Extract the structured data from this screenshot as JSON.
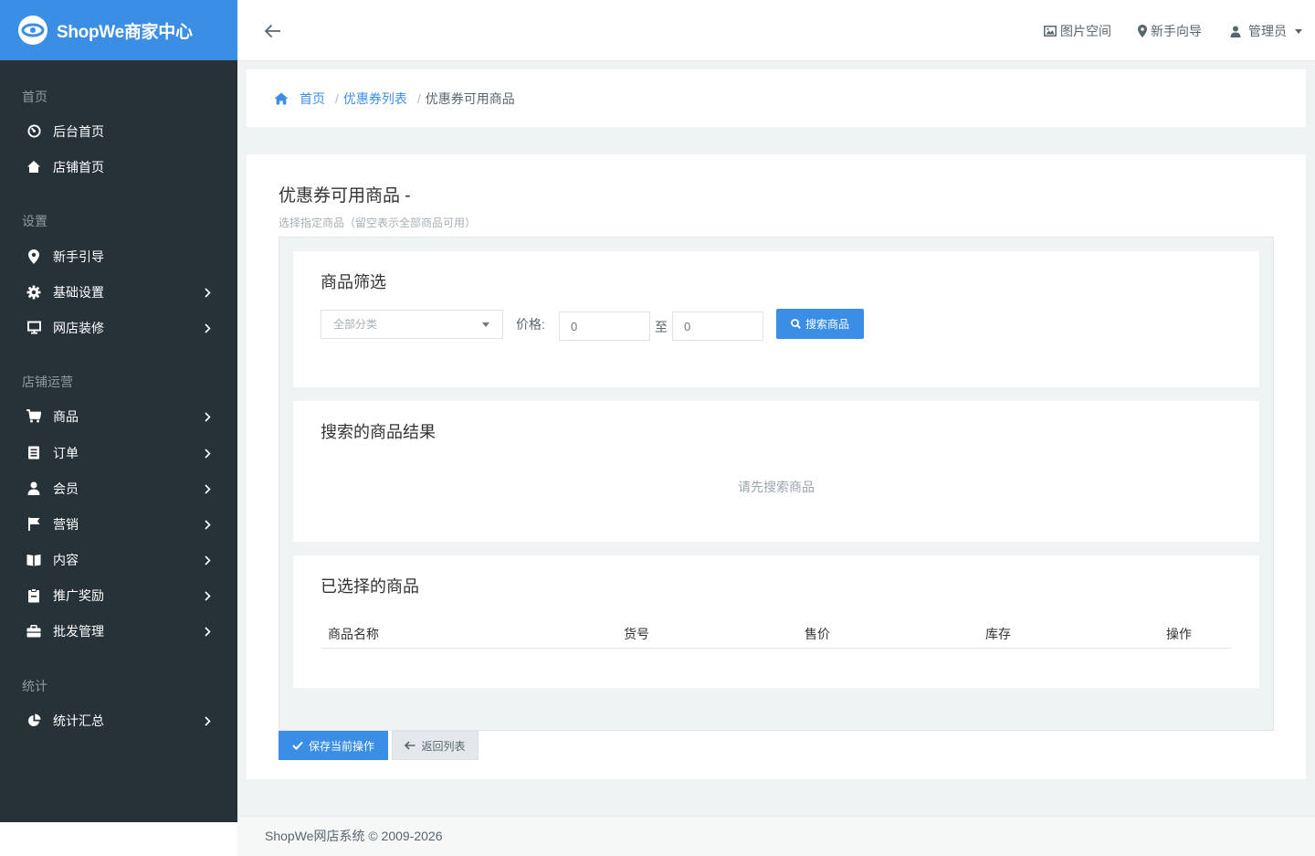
{
  "brand": {
    "title": "ShopWe商家中心"
  },
  "sidebar": {
    "sections": [
      {
        "title": "首页",
        "items": [
          {
            "label": "后台首页",
            "icon": "dashboard-icon",
            "arrow": false
          },
          {
            "label": "店铺首页",
            "icon": "home-icon",
            "arrow": false
          }
        ]
      },
      {
        "title": "设置",
        "items": [
          {
            "label": "新手引导",
            "icon": "map-marker-icon",
            "arrow": false
          },
          {
            "label": "基础设置",
            "icon": "gear-icon",
            "arrow": true
          },
          {
            "label": "网店装修",
            "icon": "monitor-icon",
            "arrow": true
          }
        ]
      },
      {
        "title": "店铺运营",
        "items": [
          {
            "label": "商品",
            "icon": "cart-icon",
            "arrow": true
          },
          {
            "label": "订单",
            "icon": "order-list-icon",
            "arrow": true
          },
          {
            "label": "会员",
            "icon": "user-icon",
            "arrow": true
          },
          {
            "label": "营销",
            "icon": "flag-icon",
            "arrow": true
          },
          {
            "label": "内容",
            "icon": "book-icon",
            "arrow": true
          },
          {
            "label": "推广奖励",
            "icon": "clipboard-icon",
            "arrow": true
          },
          {
            "label": "批发管理",
            "icon": "briefcase-icon",
            "arrow": true
          }
        ]
      },
      {
        "title": "统计",
        "items": [
          {
            "label": "统计汇总",
            "icon": "pie-chart-icon",
            "arrow": true
          }
        ]
      }
    ]
  },
  "header": {
    "images": "图片空间",
    "guide": "新手向导",
    "admin": "管理员"
  },
  "breadcrumb": {
    "home": "首页",
    "list": "优惠券列表",
    "current": "优惠券可用商品"
  },
  "main": {
    "title": "优惠券可用商品 -",
    "subtitle": "选择指定商品（留空表示全部商品可用）",
    "filter": {
      "title": "商品筛选",
      "category_value": "全部分类",
      "price_label": "价格:",
      "min_placeholder": "0",
      "to_label": "至",
      "max_placeholder": "0",
      "search_button": "搜索商品"
    },
    "results": {
      "title": "搜索的商品结果",
      "empty": "请先搜索商品"
    },
    "selected": {
      "title": "已选择的商品",
      "columns": [
        "商品名称",
        "货号",
        "售价",
        "库存",
        "操作"
      ]
    },
    "save_button": "保存当前操作",
    "back_button": "返回列表"
  },
  "footer": {
    "text": "ShopWe网店系统 © 2009-2026"
  },
  "colors": {
    "primary": "#3a8ee6",
    "sidebar": "#263238"
  }
}
